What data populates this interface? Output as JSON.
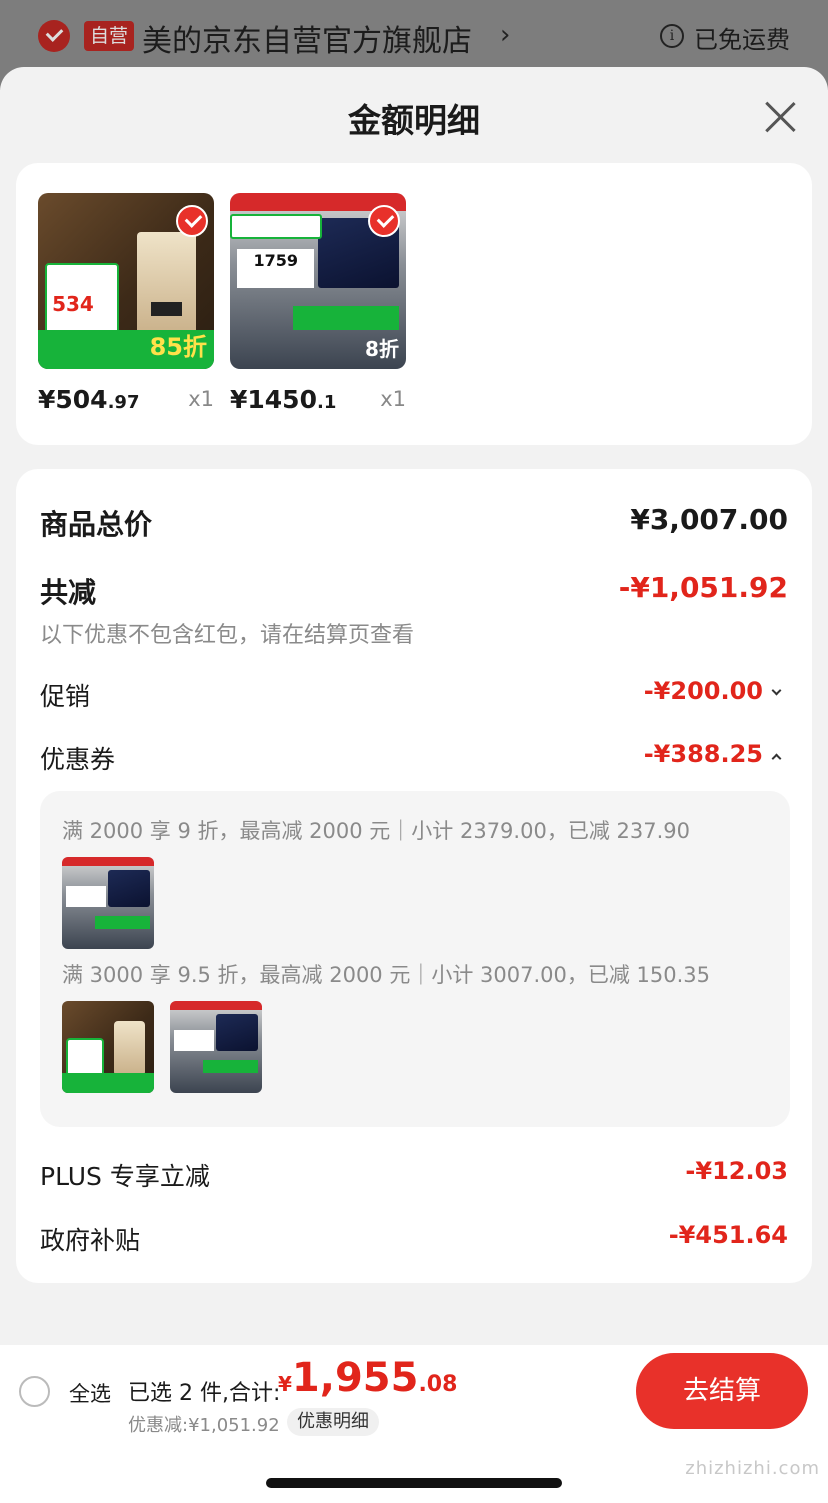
{
  "store_header": {
    "badge": "自营",
    "store_name": "美的京东自营官方旗舰店",
    "chevron": "›",
    "info_icon": "i",
    "shipping": "已免运费"
  },
  "sheet": {
    "title": "金额明细"
  },
  "products": [
    {
      "icon": "water-heater-thumbnail",
      "price_int": "¥504",
      "price_dec": ".97",
      "qty": "x1",
      "thumb_price": "534",
      "thumb_promo": "85折"
    },
    {
      "icon": "range-hood-thumbnail",
      "price_int": "¥1450",
      "price_dec": ".1",
      "qty": "x1",
      "thumb_price": "1759",
      "thumb_promo": "8折"
    }
  ],
  "summary": {
    "total_label": "商品总价",
    "total_value": "¥3,007.00",
    "reduce_label": "共减",
    "reduce_value": "-¥1,051.92",
    "reduce_note": "以下优惠不包含红包，请在结算页查看",
    "promo_label": "促销",
    "promo_value": "-¥200.00",
    "coupon_label": "优惠券",
    "coupon_value": "-¥388.25",
    "coupon_rules": [
      "满 2000 享 9 折，最高减 2000 元｜小计 2379.00，已减 237.90",
      "满 3000 享 9.5 折，最高减 2000 元｜小计 3007.00，已减 150.35"
    ],
    "plus_label": "PLUS 专享立减",
    "plus_value": "-¥12.03",
    "gov_label": "政府补贴",
    "gov_value": "-¥451.64"
  },
  "bottom_bar": {
    "select_all": "全选",
    "selected_count": "已选 2 件,合计:",
    "total_currency": "¥",
    "total_int": "1,955",
    "total_dec": ".08",
    "discount": "优惠减:¥1,051.92",
    "detail_label": "优惠明细",
    "checkout_label": "去结算"
  },
  "watermark": "zhizhizhi.com",
  "colors": {
    "accent_red": "#e1251b",
    "checkout_red": "#e8312a",
    "green": "#17b33a"
  }
}
